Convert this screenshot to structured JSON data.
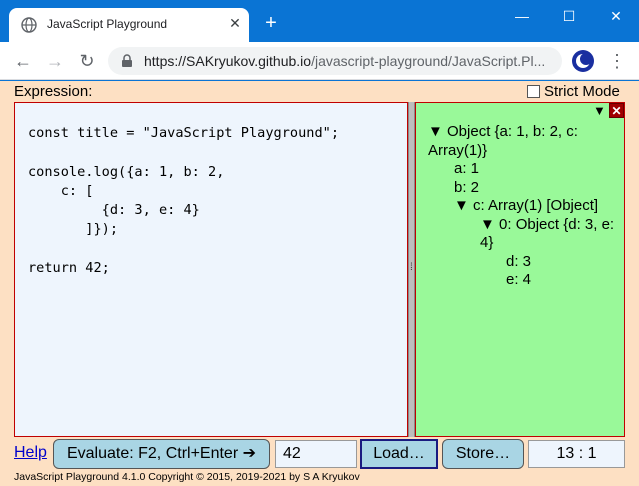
{
  "browser": {
    "tab_title": "JavaScript Playground",
    "tab_close_glyph": "✕",
    "new_tab_glyph": "+",
    "minimize_glyph": "—",
    "maximize_glyph": "☐",
    "close_glyph": "✕",
    "back_glyph": "←",
    "forward_glyph": "→",
    "reload_glyph": "↻",
    "menu_glyph": "⋮",
    "url_host": "https://SAKryukov.github.io",
    "url_path": "/javascript-playground/JavaScript.Pl..."
  },
  "app": {
    "expression_label": "Expression:",
    "strict_mode_label": "Strict Mode",
    "strict_mode_checked": false,
    "code": "const title = \"JavaScript Playground\";\n\nconsole.log({a: 1, b: 2,\n    c: [\n         {d: 3, e: 4}\n       ]});\n\nreturn 42;",
    "result_tree": [
      {
        "indent": 0,
        "text": "▼ Object {a: 1, b: 2, c: Array(1)}"
      },
      {
        "indent": 1,
        "text": "a: 1"
      },
      {
        "indent": 1,
        "text": "b: 2"
      },
      {
        "indent": 1,
        "text": "▼ c: Array(1) [Object]"
      },
      {
        "indent": 2,
        "text": "▼ 0: Object {d: 3, e: 4}"
      },
      {
        "indent": 3,
        "text": "d: 3"
      },
      {
        "indent": 3,
        "text": "e: 4"
      }
    ],
    "collapse_glyph": "▼",
    "close_glyph": "✕",
    "help_label": "Help",
    "evaluate_label": "Evaluate: F2, Ctrl+Enter ➔",
    "result_value": "42",
    "load_label": "Load…",
    "store_label": "Store…",
    "cursor_position": "13 : 1",
    "footer": "JavaScript Playground 4.1.0   Copyright © 2015, 2019-2021 by S A Kryukov"
  },
  "colors": {
    "titlebar": "#0a74d4",
    "app_background": "#fde0c3",
    "editor_background": "#eef5fd",
    "result_background": "#99f999",
    "button": "#a9d5e4",
    "panel_border": "#c00000"
  }
}
